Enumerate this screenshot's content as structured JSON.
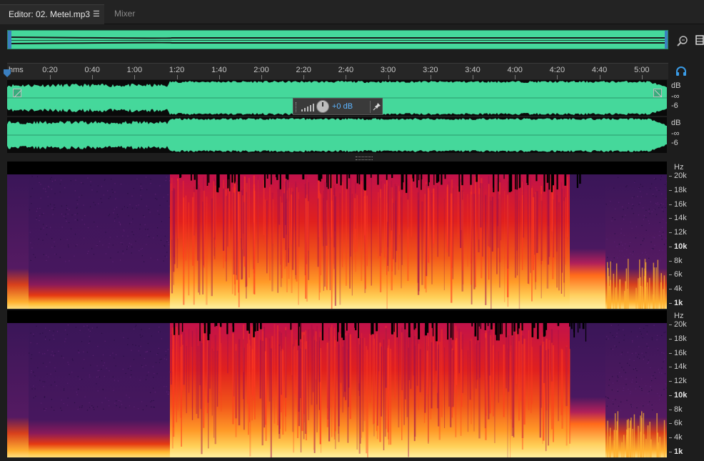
{
  "tabs": [
    {
      "label": "Editor: 02. Metel.mp3",
      "active": true,
      "menu_icon": "hamburger-icon"
    },
    {
      "label": "Mixer",
      "active": false
    }
  ],
  "ruler": {
    "unit": "hms",
    "labels": [
      "0:20",
      "0:40",
      "1:00",
      "1:20",
      "1:40",
      "2:00",
      "2:20",
      "2:40",
      "3:00",
      "3:20",
      "3:40",
      "4:00",
      "4:20",
      "4:40",
      "5:00"
    ]
  },
  "hud": {
    "gain": "+0 dB"
  },
  "waveform_scale": {
    "channel1": {
      "unit": "dB",
      "v1": "-∞",
      "v2": "-6"
    },
    "channel2": {
      "unit": "dB",
      "v1": "-∞",
      "v2": "-6"
    }
  },
  "spectral_scale": {
    "unit": "Hz",
    "labels": [
      "20k",
      "18k",
      "16k",
      "14k",
      "12k",
      "10k",
      "8k",
      "6k",
      "4k",
      "1k"
    ]
  },
  "colors": {
    "waveform": "#45d89b",
    "accent": "#3a9be6",
    "hud_text": "#5db4ff"
  }
}
